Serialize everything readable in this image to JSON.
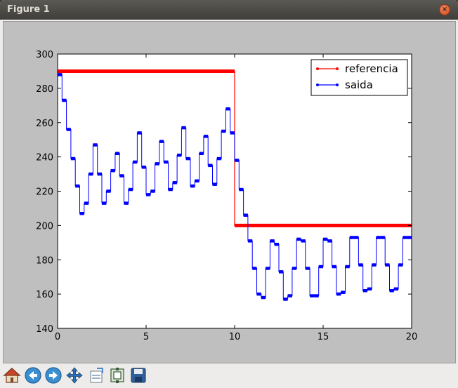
{
  "window": {
    "title": "Figure 1",
    "close_glyph": "×"
  },
  "toolbar": {
    "buttons": [
      {
        "name": "home-icon",
        "label": "Home"
      },
      {
        "name": "back-icon",
        "label": "Back"
      },
      {
        "name": "forward-icon",
        "label": "Forward"
      },
      {
        "name": "pan-icon",
        "label": "Pan"
      },
      {
        "name": "configure-subplots-icon",
        "label": "Subplots"
      },
      {
        "name": "zoom-icon",
        "label": "Zoom"
      },
      {
        "name": "save-icon",
        "label": "Save"
      }
    ]
  },
  "colors": {
    "referencia": "#ff0000",
    "saida": "#0000ff",
    "figure_bg": "#bfbfbf",
    "axes_bg": "#ffffff"
  },
  "chart_data": {
    "type": "line",
    "title": "",
    "xlabel": "",
    "ylabel": "",
    "xlim": [
      0,
      20
    ],
    "ylim": [
      140,
      300
    ],
    "xticks": [
      0,
      5,
      10,
      15,
      20
    ],
    "xtick_labels": [
      "0",
      "5",
      "10",
      "15",
      "20"
    ],
    "yticks": [
      140,
      160,
      180,
      200,
      220,
      240,
      260,
      280,
      300
    ],
    "ytick_labels": [
      "140",
      "160",
      "180",
      "200",
      "220",
      "240",
      "260",
      "280",
      "300"
    ],
    "grid": false,
    "legend": {
      "position": "upper right",
      "entries": [
        "referencia",
        "saida"
      ]
    },
    "series": [
      {
        "name": "referencia",
        "color": "#ff0000",
        "step": true,
        "x": [
          0,
          10,
          10,
          20
        ],
        "y": [
          290,
          290,
          200,
          200
        ]
      },
      {
        "name": "saida",
        "color": "#0000ff",
        "step": true,
        "x": [
          0,
          0.25,
          0.5,
          0.75,
          1.0,
          1.25,
          1.5,
          1.75,
          2.0,
          2.25,
          2.5,
          2.75,
          3.0,
          3.25,
          3.5,
          3.75,
          4.0,
          4.25,
          4.5,
          4.75,
          5.0,
          5.25,
          5.5,
          5.75,
          6.0,
          6.25,
          6.5,
          6.75,
          7.0,
          7.25,
          7.5,
          7.75,
          8.0,
          8.25,
          8.5,
          8.75,
          9.0,
          9.25,
          9.5,
          9.75,
          10.0,
          10.25,
          10.5,
          10.75,
          11.0,
          11.25,
          11.5,
          11.75,
          12.0,
          12.25,
          12.5,
          12.75,
          13.0,
          13.25,
          13.5,
          13.75,
          14.0,
          14.25,
          14.5,
          14.75,
          15.0,
          15.25,
          15.5,
          15.75,
          16.0,
          16.25,
          16.5,
          16.75,
          17.0,
          17.25,
          17.5,
          17.75,
          18.0,
          18.25,
          18.5,
          18.75,
          19.0,
          19.25,
          19.5,
          19.75,
          20.0
        ],
        "y": [
          288,
          273,
          256,
          239,
          223,
          207,
          213,
          230,
          247,
          230,
          213,
          220,
          232,
          242,
          229,
          213,
          221,
          237,
          254,
          234,
          218,
          220,
          236,
          249,
          237,
          221,
          225,
          241,
          257,
          239,
          223,
          226,
          242,
          252,
          235,
          224,
          239,
          255,
          268,
          254,
          238,
          221,
          206,
          191,
          175,
          160,
          158,
          175,
          191,
          189,
          173,
          157,
          159,
          175,
          192,
          191,
          175,
          159,
          159,
          176,
          192,
          191,
          176,
          160,
          161,
          176,
          193,
          193,
          177,
          162,
          163,
          177,
          193,
          193,
          177,
          162,
          163,
          177,
          193,
          193,
          177
        ]
      }
    ]
  }
}
